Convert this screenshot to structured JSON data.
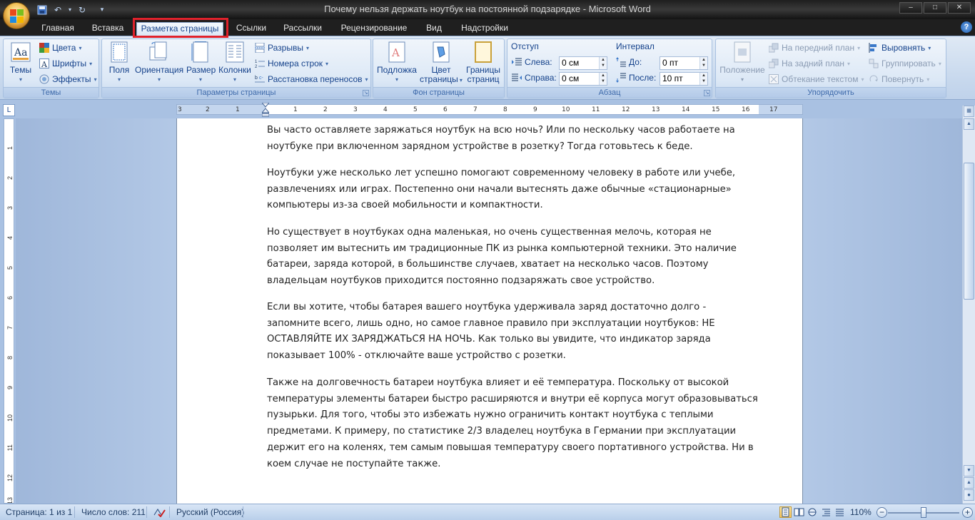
{
  "window": {
    "title": "Почему нельзя держать ноутбук на постоянной подзарядке - Microsoft Word",
    "controls": [
      "–",
      "□",
      "✕"
    ]
  },
  "tabs": [
    "Главная",
    "Вставка",
    "Разметка страницы",
    "Ссылки",
    "Рассылки",
    "Рецензирование",
    "Вид",
    "Надстройки"
  ],
  "active_tab": "Разметка страницы",
  "ribbon": {
    "themes": {
      "label": "Темы",
      "big": "Темы",
      "colors": "Цвета",
      "fonts": "Шрифты",
      "effects": "Эффекты"
    },
    "page_setup": {
      "label": "Параметры страницы",
      "margins": "Поля",
      "orientation": "Ориентация",
      "size": "Размер",
      "columns": "Колонки",
      "breaks": "Разрывы",
      "line_numbers": "Номера строк",
      "hyphenation": "Расстановка переносов"
    },
    "page_background": {
      "label": "Фон страницы",
      "watermark": "Подложка",
      "page_color_1": "Цвет",
      "page_color_2": "страницы",
      "page_borders_1": "Границы",
      "page_borders_2": "страниц"
    },
    "paragraph": {
      "label": "Абзац",
      "indent": "Отступ",
      "left_label": "Слева:",
      "left_value": "0 см",
      "right_label": "Справа:",
      "right_value": "0 см",
      "spacing": "Интервал",
      "before_label": "До:",
      "before_value": "0 пт",
      "after_label": "После:",
      "after_value": "10 пт"
    },
    "arrange": {
      "label": "Упорядочить",
      "position": "Положение",
      "bring_front": "На передний план",
      "send_back": "На задний план",
      "text_wrap": "Обтекание текстом",
      "align": "Выровнять",
      "group": "Группировать",
      "rotate": "Повернуть"
    }
  },
  "ruler": {
    "h_ticks": [
      "3",
      "2",
      "1",
      "1",
      "2",
      "3",
      "4",
      "5",
      "6",
      "7",
      "8",
      "9",
      "10",
      "11",
      "12",
      "13",
      "14",
      "15",
      "16",
      "17"
    ],
    "v_ticks": [
      "1",
      "2",
      "3",
      "4",
      "5",
      "6",
      "7",
      "8",
      "9",
      "10",
      "11",
      "12",
      "13"
    ]
  },
  "document": {
    "paragraphs": [
      "Вы часто оставляете заряжаться ноутбук на всю ночь? Или  по нескольку часов работаете  на ноутбуке при включенном зарядном устройстве  в розетку?   Тогда готовьтесь к беде.",
      "Ноутбуки уже несколько  лет успешно помогают современному человеку в работе или учебе, развлечениях или играх. Постепенно они начали вытеснять даже обычные «стационарные» компьютеры из-за своей мобильности и компактности.",
      "Но существует  в ноутбуках одна маленькая, но очень существенная мелочь, которая  не позволяет им вытеснить им традиционные ПК из рынка компьютерной  техники. Это наличие батареи, заряда которой,  в большинстве случаев, хватает на несколько часов. Поэтому  владельцам ноутбуков приходится постоянно подзаряжать  свое устройство.",
      "Если вы хотите, чтобы батарея вашего ноутбука  удерживала заряд достаточно долго  - запомните всего, лишь одно, но самое главное правило при эксплуатации ноутбуков:  НЕ ОСТАВЛЯЙТЕ ИХ ЗАРЯДЖАТЬСЯ НА НОЧЬ. Как только вы увидите, что индикатор заряда показывает 100% - отключайте ваше устройство  с розетки.",
      "Также на долговечность батареи ноутбука влияет и её температура.  Поскольку  от высокой температуры  элементы батареи быстро расширяются и внутри её корпуса  могут образовываться пузырьки. Для того, чтобы это избежать нужно ограничить контакт ноутбука  с теплыми предметами. К примеру, по статистике 2/3 владелец ноутбука в Германии при эксплуатации держит его на коленях, тем самым повышая температуру  своего портативного  устройства. Ни в коем случае не поступайте также."
    ]
  },
  "status": {
    "page": "Страница: 1 из 1",
    "words": "Число слов: 211",
    "language": "Русский (Россия)",
    "zoom": "110%",
    "zoom_minus": "−",
    "zoom_plus": "+"
  }
}
